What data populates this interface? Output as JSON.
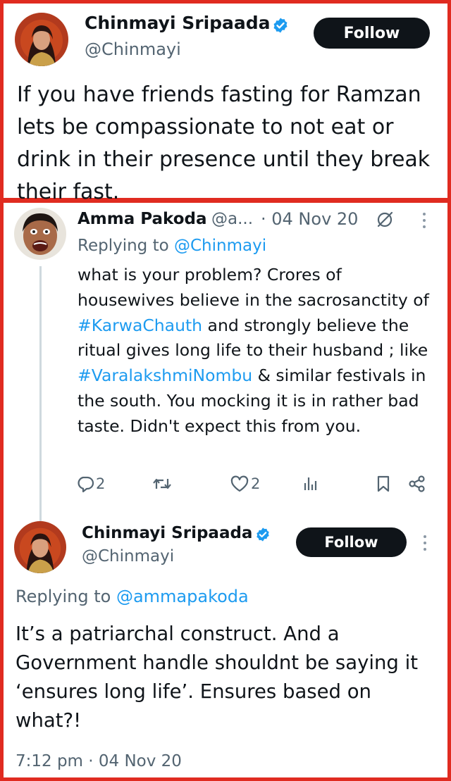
{
  "tweet1": {
    "author_name": "Chinmayi Sripaada",
    "author_handle": "@Chinmayi",
    "follow_label": "Follow",
    "text": "If you have friends fasting for Ramzan lets be compassionate to not eat or drink in their presence until they break their fast."
  },
  "tweet2": {
    "author_name": "Amma Pakoda",
    "author_handle": "@a...",
    "date": "· 04 Nov 20",
    "replying_label": "Replying to",
    "replying_handle": "@Chinmayi",
    "text_parts": {
      "p1": "what is your problem? Crores of housewives believe in the sacrosanctity of ",
      "tag1": "#KarwaChauth",
      "p2": " and strongly believe the ritual gives long life to their husband ; like ",
      "tag2": "#VaralakshmiNombu",
      "p3": " & similar festivals in the south. You mocking it is in rather bad taste. Didn't expect this from you."
    },
    "actions": {
      "reply_count": "2",
      "like_count": "2"
    }
  },
  "tweet3": {
    "author_name": "Chinmayi Sripaada",
    "author_handle": "@Chinmayi",
    "follow_label": "Follow",
    "replying_label": "Replying to",
    "replying_handle": "@ammapakoda",
    "text": "It’s a patriarchal construct. And a Government handle shouldnt be saying it ‘ensures long life’. Ensures based on what?!",
    "timestamp": "7:12 pm · 04 Nov 20"
  },
  "icons": {
    "verified": "verified-badge-icon",
    "more": "more-icon",
    "reply": "reply-icon",
    "retweet": "retweet-icon",
    "like": "like-icon",
    "views": "views-icon",
    "bookmark": "bookmark-icon",
    "share": "share-icon",
    "edited": "edited-icon"
  },
  "colors": {
    "highlight_border": "#e02b20",
    "link": "#1d9bf0",
    "verified": "#1d9bf0",
    "muted": "#536471",
    "button": "#0f1419"
  }
}
